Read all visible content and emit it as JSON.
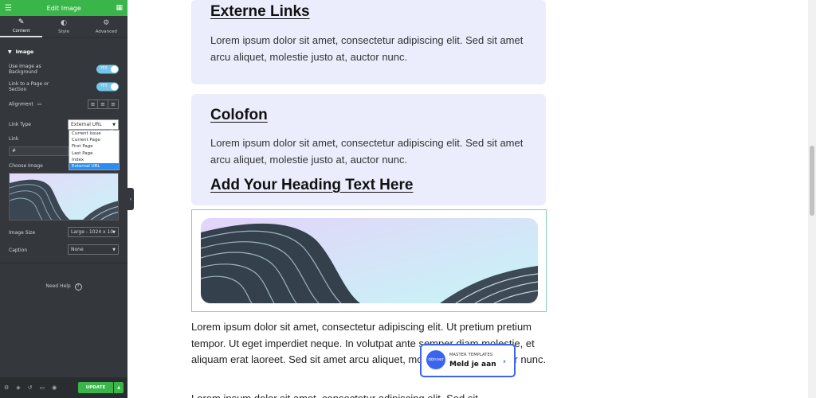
{
  "sidebar": {
    "title": "Edit Image",
    "tabs": [
      {
        "label": "Content",
        "icon": "pencil-icon"
      },
      {
        "label": "Style",
        "icon": "half-circle-icon"
      },
      {
        "label": "Advanced",
        "icon": "gear-icon"
      }
    ],
    "section_title": "Image",
    "use_image_bg_label": "Use Image as Background",
    "link_section_label": "Link to a Page or Section",
    "toggle_text": "YES",
    "alignment_label": "Alignment",
    "link_type_label": "Link Type",
    "link_type_value": "External URL",
    "link_type_options": [
      "Current Issue",
      "Current Page",
      "First Page",
      "Last Page",
      "Index",
      "External URL"
    ],
    "link_label": "Link",
    "link_value": "#",
    "choose_image_label": "Choose Image",
    "image_size_label": "Image Size",
    "image_size_value": "Large - 1024 x 10",
    "caption_label": "Caption",
    "caption_value": "None",
    "need_help": "Need Help",
    "update_label": "UPDATE"
  },
  "preview": {
    "card1": {
      "heading": "Externe Links",
      "text": "Lorem ipsum dolor sit amet, consectetur adipiscing elit. Sed sit amet arcu aliquet, molestie justo at, auctor nunc."
    },
    "card2": {
      "heading": "Colofon",
      "text": "Lorem ipsum dolor sit amet, consectetur adipiscing elit. Sed sit amet arcu aliquet, molestie justo at, auctor nunc.",
      "heading2": "Add Your Heading Text Here"
    },
    "body_text": "Lorem ipsum dolor sit amet, consectetur adipiscing elit. Ut pretium pretium tempor. Ut eget imperdiet neque. In volutpat ante semper diam molestie, et aliquam erat laoreet. Sed sit amet arcu aliquet, molestie justo at, auctor nunc.",
    "body_text_2": "Lorem ipsum dolor sit amet, consectetur adipiscing elit. Sed sit"
  },
  "popup": {
    "logo_text": "dönner",
    "small_text": "MASTER TEMPLATES",
    "big_text": "Meld je aan"
  },
  "colors": {
    "accent_green": "#39b54a",
    "panel_dark": "#34383c",
    "card_bg": "#ebedfd",
    "selected_blue": "#2d8cf0",
    "popup_blue": "#3b64f0"
  }
}
